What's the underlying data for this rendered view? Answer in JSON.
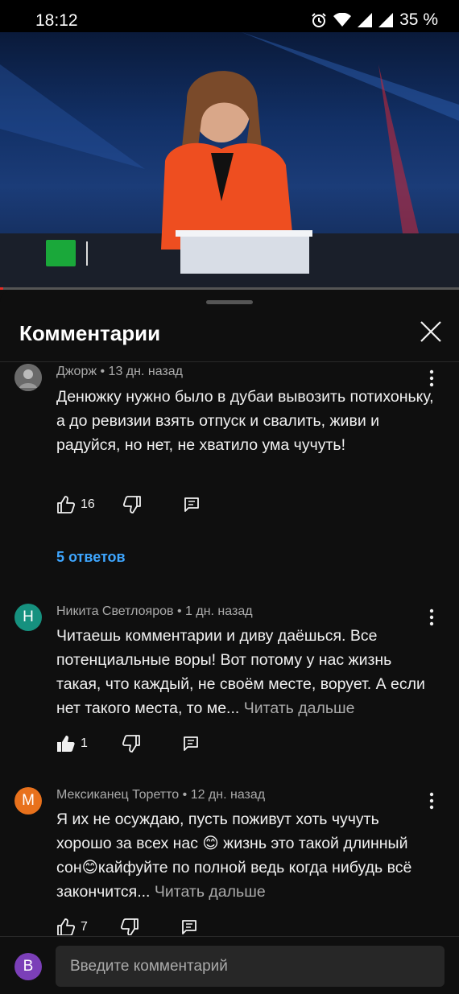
{
  "status_bar": {
    "time": "18:12",
    "battery": "35 %"
  },
  "video": {
    "progress": 0.007
  },
  "sheet": {
    "title": "Комментарии"
  },
  "comments": [
    {
      "author": "Джорж",
      "age": "13 дн. назад",
      "avatar_letter": "",
      "avatar_color": "#888888",
      "text": "Денюжку нужно было в дубаи вывозить потихоньку, а до ревизии взять отпуск и свалить, живи и радуйся, но нет, не хватило ума чучуть!",
      "likes": "16",
      "replies": "5 ответов"
    },
    {
      "author": "Никита Светлояров",
      "age": "1 дн. назад",
      "avatar_letter": "Н",
      "avatar_color": "#16917f",
      "text": "Читаешь комментарии и диву даёшься. Все потенциальные воры! Вот потому у нас жизнь такая, что каждый, не своём месте, ворует. А если нет такого места, то ме...",
      "read_more": "Читать дальше",
      "likes": "1"
    },
    {
      "author": "Мексиканец Торетто",
      "age": "12 дн. назад",
      "avatar_letter": "М",
      "avatar_color": "#e8711c",
      "text": "Я их не осуждаю, пусть поживут хоть чучуть хорошо за всех нас 😊 жизнь это такой длинный сон😊кайфуйте по полной ведь когда нибудь всё закончится...",
      "read_more": "Читать дальше",
      "likes": "7"
    }
  ],
  "input": {
    "avatar_letter": "В",
    "placeholder": "Введите комментарий"
  }
}
